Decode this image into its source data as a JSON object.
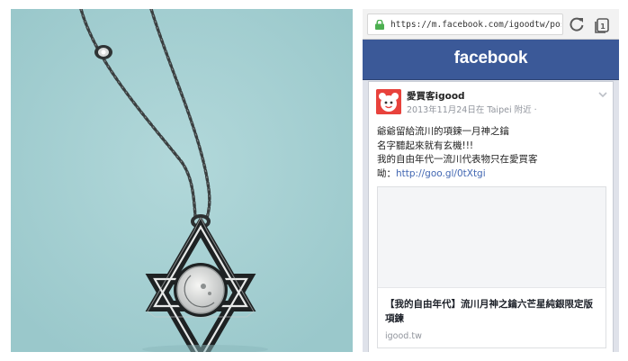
{
  "browser": {
    "url": "https://m.facebook.com/igoodtw/pos",
    "lock_icon": "lock-icon",
    "reload_icon": "reload-icon",
    "tabs_icon": "tabs-icon",
    "tab_count": "1"
  },
  "facebook": {
    "logo": "facebook"
  },
  "post": {
    "author": "愛買客igood",
    "meta": "2013年11月24日在 Taipei 附近 ·",
    "lines": [
      "爺爺留給流川的項鍊一月神之鑰",
      "名字聽起來就有玄機!!!",
      "我的自由年代一流川代表物只在愛買客"
    ],
    "link_prefix": "呦：",
    "link_text": "http://goo.gl/0tXtgi",
    "preview": {
      "title": "【我的自由年代】流川月神之鑰六芒星純銀限定版項鍊",
      "domain": "igood.tw"
    }
  },
  "colors": {
    "photo_background": "#a5cfd2",
    "facebook_blue": "#3b5998",
    "link_blue": "#4267b2",
    "secure_green": "#4caf50",
    "avatar_red": "#e8423c"
  }
}
